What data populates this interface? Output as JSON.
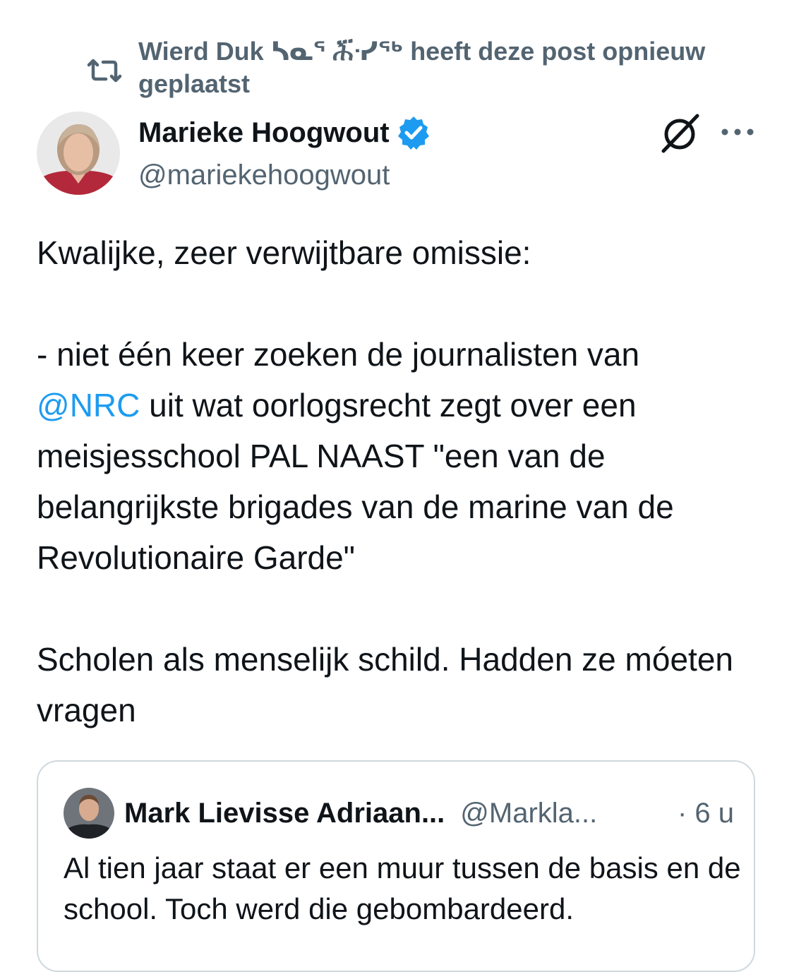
{
  "repost": {
    "text_before": "Wierd Duk ",
    "glyphs": "ᓴᓇᕐ ሕ፝ᓸᖅ",
    "text_after": " heeft deze post opnieuw geplaatst",
    "icon": "repost-icon"
  },
  "author": {
    "name": "Marieke Hoogwout",
    "handle": "@mariekehoogwout",
    "verified_icon": "verified-badge-icon",
    "avatar_icon": "avatar"
  },
  "actions": {
    "grok_icon": "grok-icon",
    "more_icon": "more-icon"
  },
  "tweet": {
    "line1": "Kwalijke, zeer verwijtbare omissie:",
    "para2_start": "- niet één keer zoeken de journalisten van",
    "mention": "@NRC",
    "para2_end": " uit wat oorlogsrecht zegt over een meisjesschool PAL NAAST \"een van de belangrijkste brigades van de marine van de Revolutionaire Garde\"",
    "para3": "Scholen als menselijk schild. Hadden ze móeten vragen"
  },
  "quote": {
    "name": "Mark Lievisse Adriaan...",
    "handle": "@Markla...",
    "time": "· 6 u",
    "text": "Al tien jaar staat er een muur tussen de basis en de school. Toch werd die gebombardeerd."
  },
  "colors": {
    "text": "#0f1419",
    "secondary": "#536471",
    "accent": "#1d9bf0",
    "border": "#cfd9de"
  }
}
